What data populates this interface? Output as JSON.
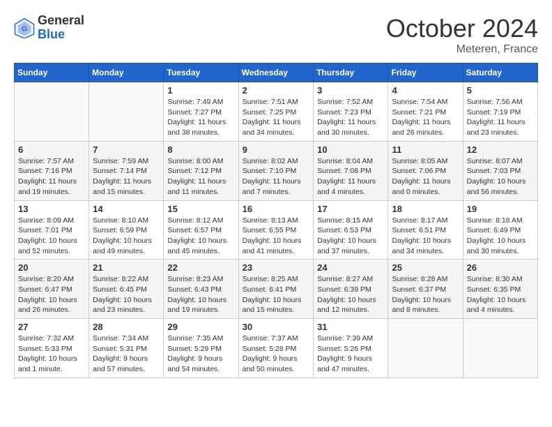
{
  "header": {
    "logo_general": "General",
    "logo_blue": "Blue",
    "month": "October 2024",
    "location": "Meteren, France"
  },
  "days_of_week": [
    "Sunday",
    "Monday",
    "Tuesday",
    "Wednesday",
    "Thursday",
    "Friday",
    "Saturday"
  ],
  "weeks": [
    [
      {
        "day": "",
        "info": ""
      },
      {
        "day": "",
        "info": ""
      },
      {
        "day": "1",
        "info": "Sunrise: 7:49 AM\nSunset: 7:27 PM\nDaylight: 11 hours and 38 minutes."
      },
      {
        "day": "2",
        "info": "Sunrise: 7:51 AM\nSunset: 7:25 PM\nDaylight: 11 hours and 34 minutes."
      },
      {
        "day": "3",
        "info": "Sunrise: 7:52 AM\nSunset: 7:23 PM\nDaylight: 11 hours and 30 minutes."
      },
      {
        "day": "4",
        "info": "Sunrise: 7:54 AM\nSunset: 7:21 PM\nDaylight: 11 hours and 26 minutes."
      },
      {
        "day": "5",
        "info": "Sunrise: 7:56 AM\nSunset: 7:19 PM\nDaylight: 11 hours and 23 minutes."
      }
    ],
    [
      {
        "day": "6",
        "info": "Sunrise: 7:57 AM\nSunset: 7:16 PM\nDaylight: 11 hours and 19 minutes."
      },
      {
        "day": "7",
        "info": "Sunrise: 7:59 AM\nSunset: 7:14 PM\nDaylight: 11 hours and 15 minutes."
      },
      {
        "day": "8",
        "info": "Sunrise: 8:00 AM\nSunset: 7:12 PM\nDaylight: 11 hours and 11 minutes."
      },
      {
        "day": "9",
        "info": "Sunrise: 8:02 AM\nSunset: 7:10 PM\nDaylight: 11 hours and 7 minutes."
      },
      {
        "day": "10",
        "info": "Sunrise: 8:04 AM\nSunset: 7:08 PM\nDaylight: 11 hours and 4 minutes."
      },
      {
        "day": "11",
        "info": "Sunrise: 8:05 AM\nSunset: 7:06 PM\nDaylight: 11 hours and 0 minutes."
      },
      {
        "day": "12",
        "info": "Sunrise: 8:07 AM\nSunset: 7:03 PM\nDaylight: 10 hours and 56 minutes."
      }
    ],
    [
      {
        "day": "13",
        "info": "Sunrise: 8:09 AM\nSunset: 7:01 PM\nDaylight: 10 hours and 52 minutes."
      },
      {
        "day": "14",
        "info": "Sunrise: 8:10 AM\nSunset: 6:59 PM\nDaylight: 10 hours and 49 minutes."
      },
      {
        "day": "15",
        "info": "Sunrise: 8:12 AM\nSunset: 6:57 PM\nDaylight: 10 hours and 45 minutes."
      },
      {
        "day": "16",
        "info": "Sunrise: 8:13 AM\nSunset: 6:55 PM\nDaylight: 10 hours and 41 minutes."
      },
      {
        "day": "17",
        "info": "Sunrise: 8:15 AM\nSunset: 6:53 PM\nDaylight: 10 hours and 37 minutes."
      },
      {
        "day": "18",
        "info": "Sunrise: 8:17 AM\nSunset: 6:51 PM\nDaylight: 10 hours and 34 minutes."
      },
      {
        "day": "19",
        "info": "Sunrise: 8:18 AM\nSunset: 6:49 PM\nDaylight: 10 hours and 30 minutes."
      }
    ],
    [
      {
        "day": "20",
        "info": "Sunrise: 8:20 AM\nSunset: 6:47 PM\nDaylight: 10 hours and 26 minutes."
      },
      {
        "day": "21",
        "info": "Sunrise: 8:22 AM\nSunset: 6:45 PM\nDaylight: 10 hours and 23 minutes."
      },
      {
        "day": "22",
        "info": "Sunrise: 8:23 AM\nSunset: 6:43 PM\nDaylight: 10 hours and 19 minutes."
      },
      {
        "day": "23",
        "info": "Sunrise: 8:25 AM\nSunset: 6:41 PM\nDaylight: 10 hours and 15 minutes."
      },
      {
        "day": "24",
        "info": "Sunrise: 8:27 AM\nSunset: 6:39 PM\nDaylight: 10 hours and 12 minutes."
      },
      {
        "day": "25",
        "info": "Sunrise: 8:28 AM\nSunset: 6:37 PM\nDaylight: 10 hours and 8 minutes."
      },
      {
        "day": "26",
        "info": "Sunrise: 8:30 AM\nSunset: 6:35 PM\nDaylight: 10 hours and 4 minutes."
      }
    ],
    [
      {
        "day": "27",
        "info": "Sunrise: 7:32 AM\nSunset: 5:33 PM\nDaylight: 10 hours and 1 minute."
      },
      {
        "day": "28",
        "info": "Sunrise: 7:34 AM\nSunset: 5:31 PM\nDaylight: 9 hours and 57 minutes."
      },
      {
        "day": "29",
        "info": "Sunrise: 7:35 AM\nSunset: 5:29 PM\nDaylight: 9 hours and 54 minutes."
      },
      {
        "day": "30",
        "info": "Sunrise: 7:37 AM\nSunset: 5:28 PM\nDaylight: 9 hours and 50 minutes."
      },
      {
        "day": "31",
        "info": "Sunrise: 7:39 AM\nSunset: 5:26 PM\nDaylight: 9 hours and 47 minutes."
      },
      {
        "day": "",
        "info": ""
      },
      {
        "day": "",
        "info": ""
      }
    ]
  ]
}
